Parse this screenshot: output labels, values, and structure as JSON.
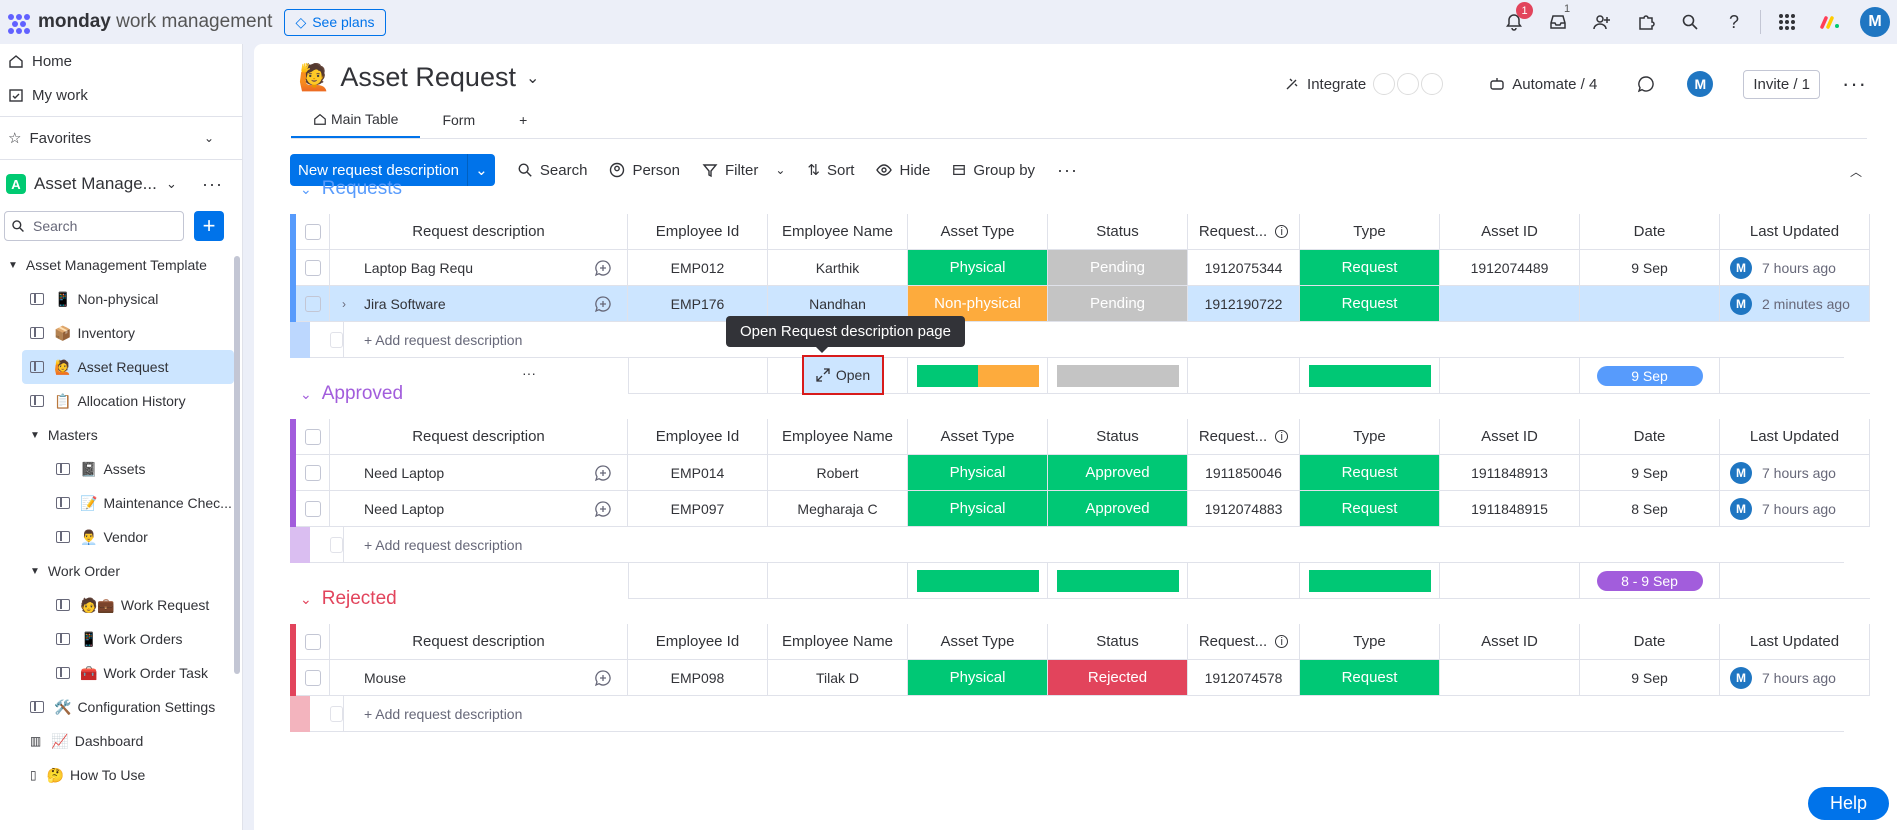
{
  "topbar": {
    "brand_bold": "monday",
    "brand_rest": " work management",
    "see_plans": "See plans",
    "notif_count": "1",
    "inbox_count": "1",
    "avatar": "M"
  },
  "sidebar": {
    "home": "Home",
    "my_work": "My work",
    "favorites": "Favorites",
    "workspace_icon": "A",
    "workspace": "Asset Manage...",
    "search_placeholder": "Search",
    "tree": [
      {
        "label": "Asset Management Template",
        "level": 0,
        "type": "folder"
      },
      {
        "label": "Non-physical",
        "level": 1,
        "type": "board",
        "emoji": "📱"
      },
      {
        "label": "Inventory",
        "level": 1,
        "type": "board",
        "emoji": "📦"
      },
      {
        "label": "Asset Request",
        "level": 1,
        "type": "board",
        "emoji": "🙋",
        "active": true
      },
      {
        "label": "Allocation History",
        "level": 1,
        "type": "board",
        "emoji": "📋"
      },
      {
        "label": "Masters",
        "level": 1,
        "type": "folder"
      },
      {
        "label": "Assets",
        "level": 2,
        "type": "board",
        "emoji": "📓"
      },
      {
        "label": "Maintenance Chec...",
        "level": 2,
        "type": "board",
        "emoji": "📝"
      },
      {
        "label": "Vendor",
        "level": 2,
        "type": "board",
        "emoji": "👨‍💼"
      },
      {
        "label": "Work Order",
        "level": 1,
        "type": "folder"
      },
      {
        "label": "Work Request",
        "level": 2,
        "type": "board",
        "emoji": "🧑💼"
      },
      {
        "label": "Work Orders",
        "level": 2,
        "type": "board",
        "emoji": "📱"
      },
      {
        "label": "Work Order Task",
        "level": 2,
        "type": "board",
        "emoji": "🧰"
      },
      {
        "label": "Configuration Settings",
        "level": 1,
        "type": "board",
        "emoji": "🛠️"
      },
      {
        "label": "Dashboard",
        "level": 1,
        "type": "dash",
        "emoji": "📈"
      },
      {
        "label": "How To Use",
        "level": 1,
        "type": "doc",
        "emoji": "🤔"
      }
    ]
  },
  "board": {
    "title": "Asset Request",
    "emoji": "🙋",
    "integrate": "Integrate",
    "automate": "Automate / 4",
    "avatar": "M",
    "invite": "Invite / 1",
    "tabs": {
      "main": "Main Table",
      "form": "Form",
      "add": "+"
    },
    "toolbar": {
      "new": "New request description",
      "search": "Search",
      "person": "Person",
      "filter": "Filter",
      "sort": "Sort",
      "hide": "Hide",
      "group_by": "Group by"
    },
    "columns": [
      "Request description",
      "Employee Id",
      "Employee Name",
      "Asset Type",
      "Status",
      "Request...",
      "Type",
      "Asset ID",
      "Date",
      "Last Updated"
    ],
    "add_row": "+ Add request description",
    "tooltip": "Open Request description page",
    "open": "Open",
    "help": "Help",
    "colors": {
      "requests": "#579bfc",
      "approved": "#a25ddc",
      "rejected": "#e2445c",
      "green": "#00c875",
      "orange": "#fdab3d",
      "grey": "#c4c4c4",
      "red": "#e2445c"
    }
  },
  "groups": [
    {
      "name": "Requests",
      "color": "#579bfc",
      "rows": [
        {
          "name": "Laptop Bag Requ",
          "emp": "EMP012",
          "ename": "Karthik",
          "atype": "Physical",
          "status": "Pending",
          "req": "1912075344",
          "type": "Request",
          "aid": "1912074489",
          "date": "9 Sep",
          "upd": "7 hours ago"
        },
        {
          "name": "Jira Software",
          "emp": "EMP176",
          "ename": "Nandhan",
          "atype": "Non-physical",
          "status": "Pending",
          "req": "1912190722",
          "type": "Request",
          "aid": "",
          "date": "",
          "upd": "2 minutes ago",
          "selected": true
        }
      ],
      "summary_date": "9 Sep"
    },
    {
      "name": "Approved",
      "color": "#a25ddc",
      "rows": [
        {
          "name": "Need Laptop",
          "emp": "EMP014",
          "ename": "Robert",
          "atype": "Physical",
          "status": "Approved",
          "req": "1911850046",
          "type": "Request",
          "aid": "1911848913",
          "date": "9 Sep",
          "upd": "7 hours ago"
        },
        {
          "name": "Need Laptop",
          "emp": "EMP097",
          "ename": "Megharaja C",
          "atype": "Physical",
          "status": "Approved",
          "req": "1912074883",
          "type": "Request",
          "aid": "1911848915",
          "date": "8 Sep",
          "upd": "7 hours ago"
        }
      ],
      "summary_date": "8 - 9 Sep"
    },
    {
      "name": "Rejected",
      "color": "#e2445c",
      "rows": [
        {
          "name": "Mouse",
          "emp": "EMP098",
          "ename": "Tilak D",
          "atype": "Physical",
          "status": "Rejected",
          "req": "1912074578",
          "type": "Request",
          "aid": "",
          "date": "9 Sep",
          "upd": "7 hours ago"
        }
      ],
      "summary_date": ""
    }
  ]
}
